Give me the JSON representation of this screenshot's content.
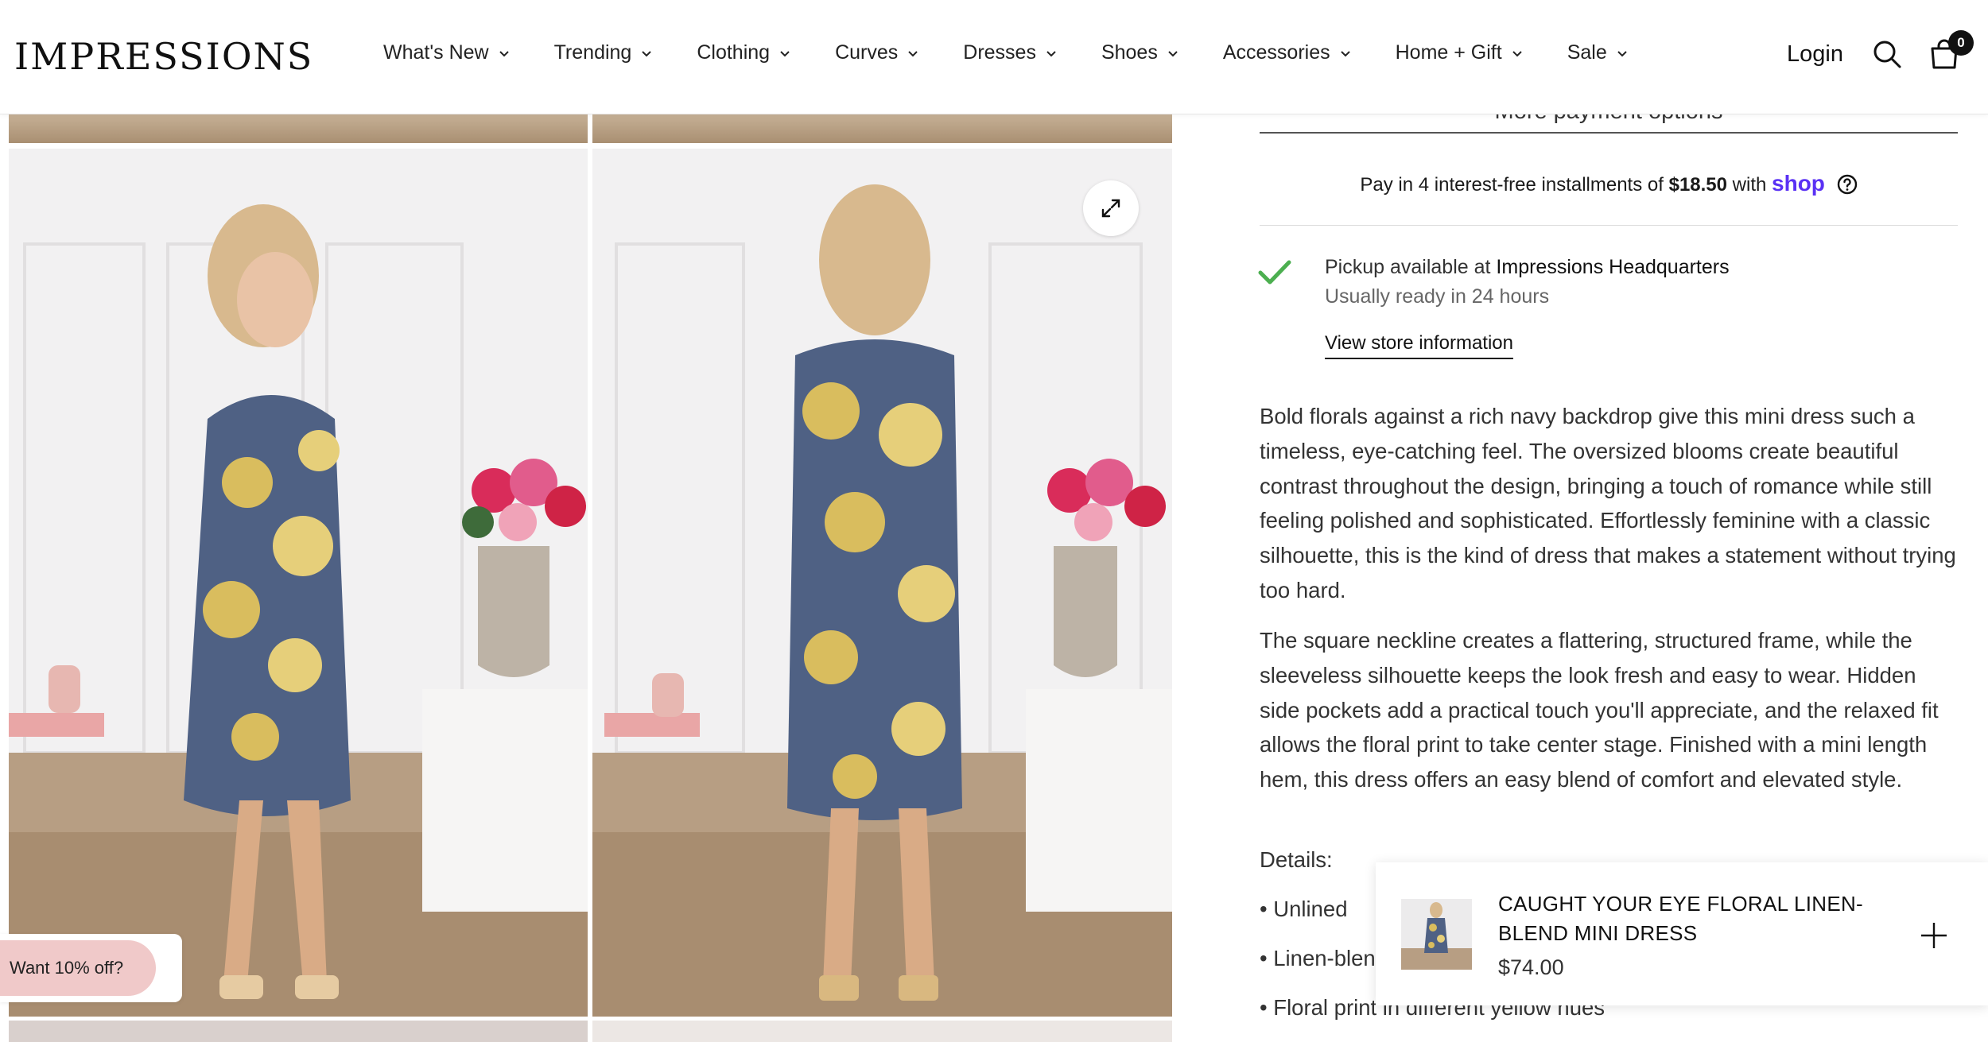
{
  "brand": {
    "logo": "IMPRESSIONS"
  },
  "nav": {
    "items": [
      {
        "label": "What's New"
      },
      {
        "label": "Trending"
      },
      {
        "label": "Clothing"
      },
      {
        "label": "Curves"
      },
      {
        "label": "Dresses"
      },
      {
        "label": "Shoes"
      },
      {
        "label": "Accessories"
      },
      {
        "label": "Home + Gift"
      },
      {
        "label": "Sale"
      }
    ],
    "login": "Login",
    "cart_count": "0"
  },
  "purchase": {
    "more_payment_options": "More payment options",
    "installments_prefix": "Pay in 4 interest-free installments of",
    "installment_amount": "$18.50",
    "installments_with": "with",
    "shop_label": "shop"
  },
  "pickup": {
    "prefix": "Pickup available at",
    "location": "Impressions Headquarters",
    "ready": "Usually ready in 24 hours",
    "store_link": "View store information"
  },
  "description": {
    "paragraph1": "Bold florals against a rich navy backdrop give this mini dress such a timeless, eye-catching feel. The oversized blooms create beautiful contrast throughout the design, bringing a touch of romance while still feeling polished and sophisticated. Effortlessly feminine with a classic silhouette, this is the kind of dress that makes a statement without trying too hard.",
    "paragraph2": "The square neckline creates a flattering, structured frame, while the sleeveless silhouette keeps the look fresh and easy to wear. Hidden side pockets add a practical touch you'll appreciate, and the relaxed fit allows the floral print to take center stage. Finished with a mini length hem, this dress offers an easy blend of comfort and elevated style.",
    "details_heading": "Details:",
    "details": [
      "• Unlined",
      "• Linen-blen",
      "• Floral print in different yellow hues"
    ]
  },
  "sticky_bar": {
    "title": "CAUGHT YOUR EYE FLORAL LINEN-BLEND MINI DRESS",
    "price": "$74.00"
  },
  "promo": {
    "label": "Want 10% off?"
  },
  "colors": {
    "dress_navy": "#4f6184",
    "bloom_yellow": "#d9bd5e",
    "check_green": "#4caf50",
    "shop_purple": "#5a31f4",
    "promo_pink": "#f0c9c9"
  },
  "icons": [
    "chevron-down-icon",
    "search-icon",
    "cart-icon",
    "expand-icon",
    "help-icon",
    "check-icon",
    "plus-icon"
  ]
}
